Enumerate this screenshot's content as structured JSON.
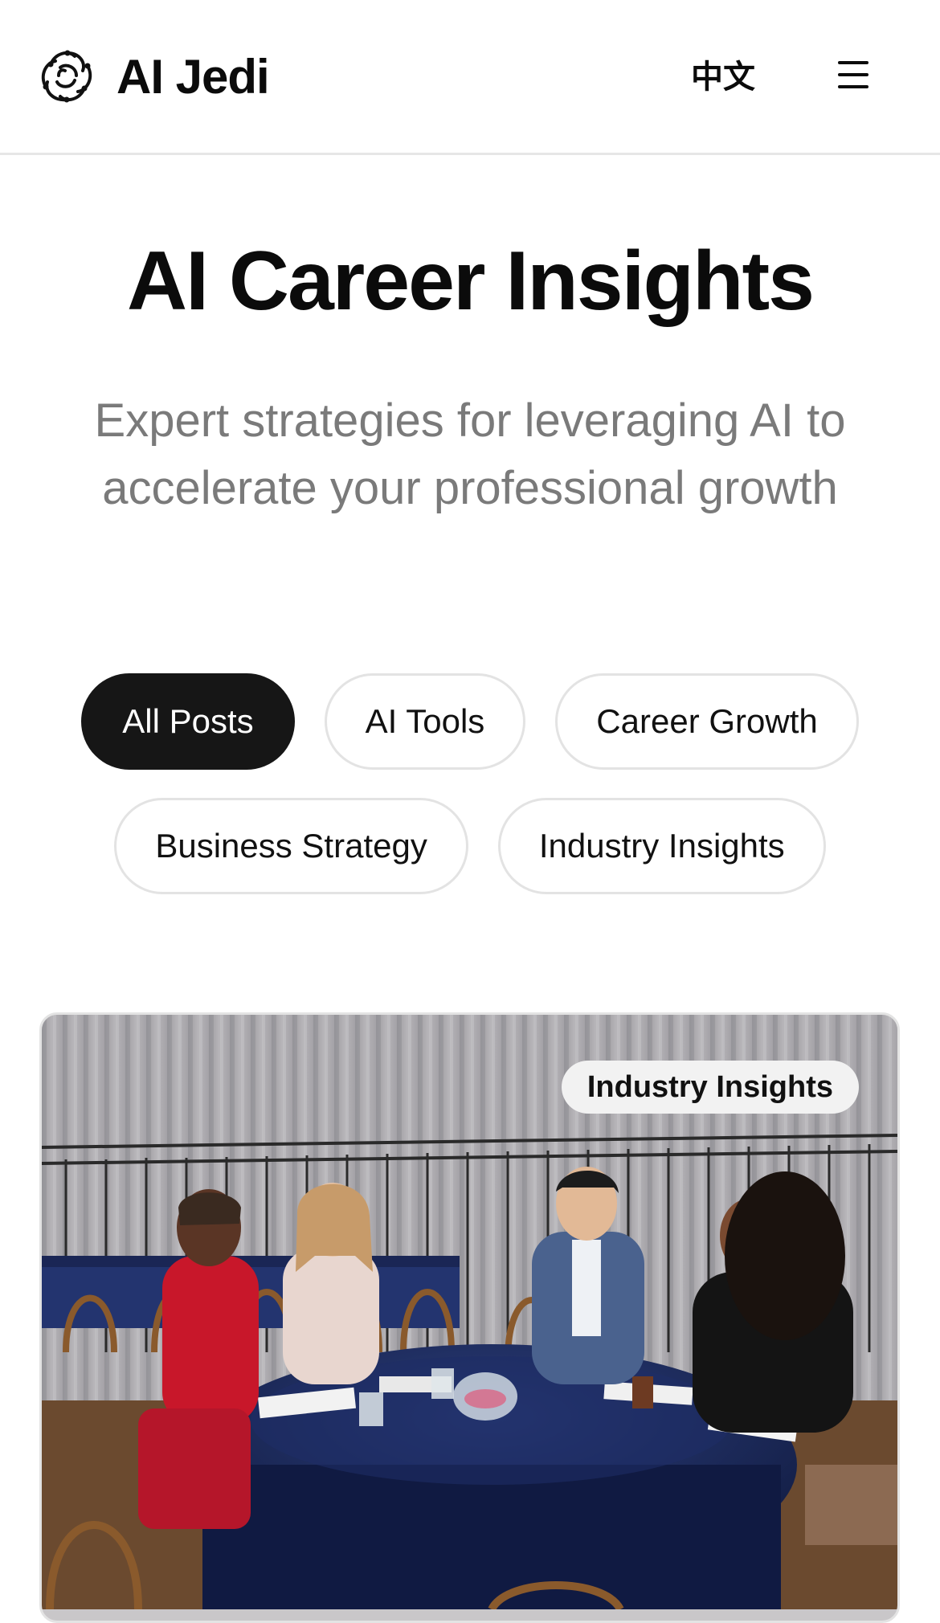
{
  "header": {
    "logo_text": "AI Jedi",
    "language_label": "中文",
    "logo_icon": "knot-logo-icon",
    "menu_icon": "hamburger-menu-icon"
  },
  "hero": {
    "title": "AI Career Insights",
    "subtitle": "Expert strategies for leveraging AI to accelerate your professional growth"
  },
  "filters": {
    "items": [
      {
        "label": "All Posts",
        "active": true
      },
      {
        "label": "AI Tools",
        "active": false
      },
      {
        "label": "Career Growth",
        "active": false
      },
      {
        "label": "Business Strategy",
        "active": false
      },
      {
        "label": "Industry Insights",
        "active": false
      }
    ]
  },
  "featured_post": {
    "category_badge": "Industry Insights"
  },
  "colors": {
    "active_pill_bg": "#161616",
    "pill_border": "#e3e3e3",
    "subtitle_text": "#7a7a7a",
    "header_divider": "#e6e6e6"
  }
}
